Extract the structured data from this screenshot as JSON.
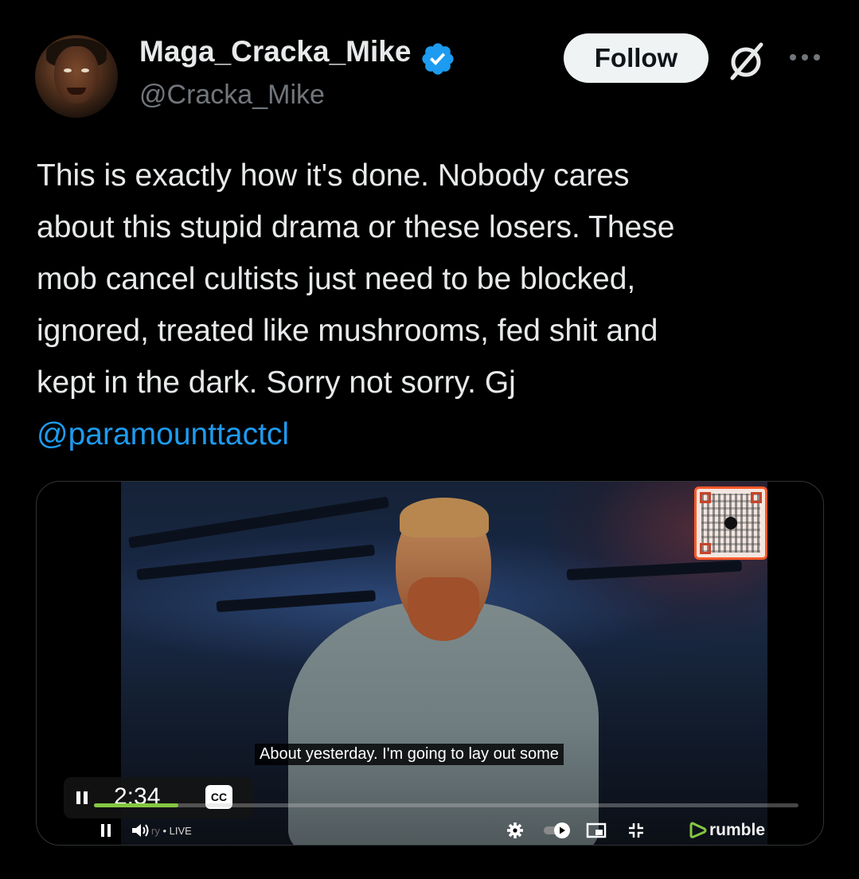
{
  "author": {
    "display_name": "Maga_Cracka_Mike",
    "handle": "@Cracka_Mike",
    "verified_icon": "verified-badge-icon"
  },
  "actions": {
    "follow_label": "Follow",
    "grok_icon": "grok-icon",
    "more_icon": "more-options-icon"
  },
  "tweet": {
    "lines": [
      "This is exactly how it's done.  Nobody cares",
      "about this stupid drama or these losers.  These",
      "mob cancel cultists just need to be blocked,",
      "ignored, treated like mushrooms, fed shit and",
      "kept in the dark.  Sorry not sorry.  Gj"
    ],
    "mention": "@paramounttactcl"
  },
  "video": {
    "caption": "About yesterday. I'm going to lay out some",
    "elapsed_time": "2:34",
    "cc_label": "CC",
    "progress_fraction": 0.12,
    "live_partial": "ry",
    "live_label": "• LIVE",
    "brand_label": "rumble"
  },
  "colors": {
    "background": "#000000",
    "text": "#e7e9ea",
    "secondary_text": "#71767b",
    "link": "#1d9bf0",
    "verified": "#1d9bf0",
    "rumble_green": "#85c742",
    "qr_border": "#ff5a2a"
  }
}
